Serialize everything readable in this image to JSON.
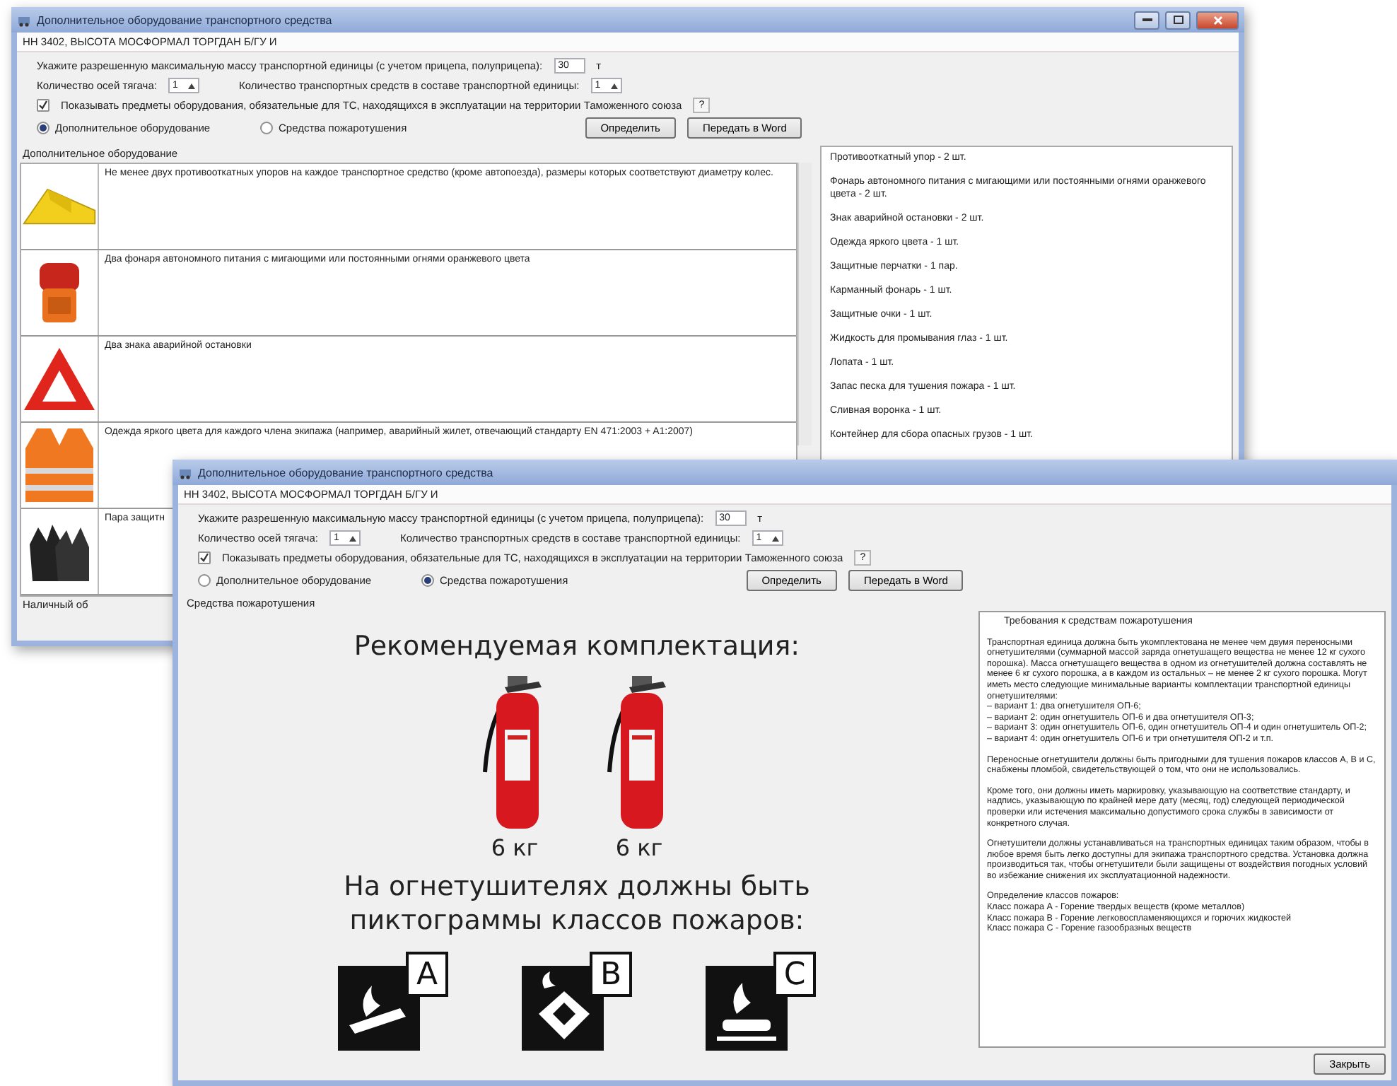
{
  "windows": [
    {
      "kind": "equipment",
      "title": "Дополнительное оборудование транспортного средства",
      "title_buttons": true,
      "subject": "НН 3402, ВЫСОТА МОСФОРМАЛ ТОРГДАН Б/ГУ И",
      "form": {
        "mass_label": "Укажите разрешенную максимальную массу транспортной единицы (с учетом прицепа, полуприцепа):",
        "mass_value": "30",
        "mass_unit": "т",
        "axles_label": "Количество осей тягача:",
        "axles_value": "1",
        "units_label": "Количество транспортных средств в составе транспортной единицы:",
        "units_value": "1",
        "show_label": "Показывать предметы оборудования, обязательные для ТС, находящихся в эксплуатации на территории Таможенного союза",
        "show_checked": true,
        "help": "?",
        "modes": [
          {
            "label": "Дополнительное оборудование",
            "selected": true
          },
          {
            "label": "Средства пожаротушения",
            "selected": false
          }
        ],
        "buttons": [
          "Определить",
          "Передать в Word"
        ]
      },
      "panel": {
        "group_label": "Дополнительное оборудование",
        "items": [
          {
            "kind": "chock",
            "text": "Не менее двух противооткатных упоров на каждое транспортное средство (кроме автопоезда), размеры которых соответствуют диаметру колес."
          },
          {
            "kind": "lamp",
            "text": "Два фонаря автономного питания с мигающими или постоянными огнями оранжевого цвета"
          },
          {
            "kind": "triangle",
            "text": "Два знака аварийной остановки"
          },
          {
            "kind": "vest",
            "text": "Одежда яркого цвета для каждого члена экипажа (например, аварийный жилет, отвечающий стандарту EN 471:2003 + A1:2007)"
          },
          {
            "kind": "gloves",
            "text": "Пара защитн"
          }
        ],
        "footer": "Наличный об",
        "list": [
          "Противооткатный упор - 2 шт.",
          "Фонарь автономного питания с мигающими или постоянными огнями оранжевого цвета - 2 шт.",
          "Знак аварийной остановки - 2 шт.",
          "Одежда яркого цвета - 1 шт.",
          "Защитные перчатки - 1 пар.",
          "Карманный фонарь - 1 шт.",
          "Защитные очки - 1 шт.",
          "Жидкость для промывания глаз - 1 шт.",
          "Лопата - 1 шт.",
          "Запас песка для тушения пожара - 1 шт.",
          "Сливная воронка - 1 шт.",
          "Контейнер для сбора опасных грузов - 1 шт."
        ]
      }
    },
    {
      "kind": "fire",
      "title": "Дополнительное оборудование транспортного средства",
      "title_buttons": false,
      "subject": "НН 3402, ВЫСОТА МОСФОРМАЛ ТОРГДАН Б/ГУ И",
      "form": {
        "mass_label": "Укажите разрешенную максимальную массу транспортной единицы (с учетом прицепа, полуприцепа):",
        "mass_value": "30",
        "mass_unit": "т",
        "axles_label": "Количество осей тягача:",
        "axles_value": "1",
        "units_label": "Количество транспортных средств в составе транспортной единицы:",
        "units_value": "1",
        "show_label": "Показывать предметы оборудования, обязательные для ТС, находящихся в эксплуатации на территории Таможенного союза",
        "show_checked": true,
        "help": "?",
        "modes": [
          {
            "label": "Дополнительное оборудование",
            "selected": false
          },
          {
            "label": "Средства пожаротушения",
            "selected": true
          }
        ],
        "buttons": [
          "Определить",
          "Передать в Word"
        ]
      },
      "panel": {
        "group_label": "Средства пожаротушения",
        "heading": "Рекомендуемая комплектация:",
        "extinguishers": [
          {
            "weight": "6 кг"
          },
          {
            "weight": "6 кг"
          }
        ],
        "note": "На огнетушителях должны быть пиктограммы классов пожаров:",
        "classes": [
          {
            "kind": "solid",
            "letter": "A"
          },
          {
            "kind": "liquid",
            "letter": "B"
          },
          {
            "kind": "gas",
            "letter": "C"
          }
        ],
        "requirements_title": "Требования к средствам пожаротушения",
        "requirements": [
          [
            "Транспортная единица должна быть укомплектована не менее чем двумя переносными огнетушителями (суммарной массой заряда огнетушащего вещества не менее 12 кг сухого порошка). Масса огнетушащего вещества в одном из огнетушителей должна составлять не менее 6 кг сухого порошка, а в каждом из остальных – не менее 2 кг сухого порошка. Могут иметь место следующие минимальные варианты комплектации транспортной единицы огнетушителями:",
            "– вариант 1: два огнетушителя ОП-6;",
            "– вариант 2: один огнетушитель ОП-6 и два огнетушителя ОП-3;",
            "– вариант 3: один огнетушитель ОП-6, один огнетушитель ОП-4 и один огнетушитель ОП-2;",
            "– вариант 4: один огнетушитель ОП-6 и три огнетушителя ОП-2 и т.п."
          ],
          [
            "Переносные огнетушители должны быть пригодными для тушения пожаров классов А, В и С, снабжены пломбой, свидетельствующей о том, что они не использовались."
          ],
          [
            "Кроме того, они должны иметь маркировку, указывающую на соответствие стандарту, и надпись, указывающую по крайней мере дату (месяц, год) следующей периодической проверки или истечения максимально допустимого срока службы в зависимости от конкретного случая."
          ],
          [
            "Огнетушители должны устанавливаться на транспортных единицах таким образом, чтобы в любое время быть легко доступны для экипажа транспортного средства. Установка должна производиться так, чтобы огнетушители были защищены от воздействия погодных условий во избежание снижения их эксплуатационной надежности."
          ],
          [
            "Определение классов пожаров:",
            "Класс пожара А - Горение твердых веществ (кроме металлов)",
            "Класс пожара В - Горение легковоспламеняющихся и горючих жидкостей",
            "Класс пожара С - Горение газообразных веществ"
          ]
        ],
        "close_button": "Закрыть"
      }
    }
  ]
}
